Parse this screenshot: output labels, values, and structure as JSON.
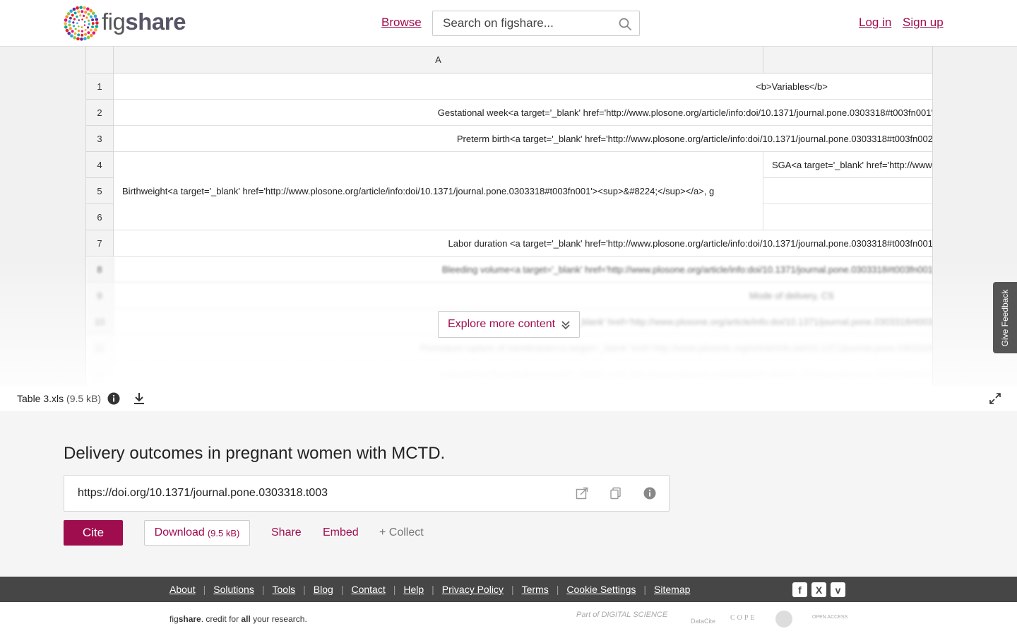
{
  "header": {
    "logo_text_light": "fig",
    "logo_text_bold": "share",
    "browse_label": "Browse",
    "search_placeholder": "Search on figshare...",
    "login_label": "Log in",
    "signup_label": "Sign up"
  },
  "sheet": {
    "column_a_label": "A",
    "column_b_label": "",
    "rows": [
      {
        "num": "1",
        "text": "<b>Variables</b>"
      },
      {
        "num": "2",
        "text": "Gestational week<a target='_blank' href='http://www.plosone.org/article/info:doi/10.1371/journal.pone.0303318#t003fn001'"
      },
      {
        "num": "3",
        "text": "Preterm birth<a target='_blank' href='http://www.plosone.org/article/info:doi/10.1371/journal.pone.0303318#t003fn002"
      },
      {
        "num": "4",
        "text": "SGA<a target='_blank' href='http://www"
      },
      {
        "num": "5",
        "text": "Birthweight<a target='_blank' href='http://www.plosone.org/article/info:doi/10.1371/journal.pone.0303318#t003fn001'><sup>&#8224;</sup></a>, g"
      },
      {
        "num": "6",
        "text": ""
      },
      {
        "num": "7",
        "text": "Labor duration <a target='_blank' href='http://www.plosone.org/article/info:doi/10.1371/journal.pone.0303318#t003fn001"
      },
      {
        "num": "8",
        "text": "Bleeding volume<a target='_blank' href='http://www.plosone.org/article/info:doi/10.1371/journal.pone.0303318#t003fn001"
      },
      {
        "num": "9",
        "text": "Mode of delivery, CS"
      },
      {
        "num": "10",
        "text": "Fetal gr... <a target='_blank' href='http://www.plosone.org/article/info:doi/10.1371/journal.pone.0303318#t003"
      },
      {
        "num": "11",
        "text": "Premature rupture of membranes<a target='_blank' href='http://www.plosone.org/article/info:doi/10.1371/journal.pone.0303318"
      },
      {
        "num": "12",
        "text": "Intrauterine fetal death<a target='_blank' href='http://www.plosone.org/article/info:doi/10.1371/journal.pone.0303318#t003"
      }
    ]
  },
  "explore_label": "Explore more content",
  "feedback_label": "Give Feedback",
  "file": {
    "name": "Table 3.xls",
    "size": "(9.5 kB)"
  },
  "item": {
    "title": "Delivery outcomes in pregnant women with MCTD.",
    "doi": "https://doi.org/10.1371/journal.pone.0303318.t003",
    "cite_label": "Cite",
    "download_label": "Download",
    "download_size": "(9.5 kB)",
    "share_label": "Share",
    "embed_label": "Embed",
    "collect_label": "+ Collect"
  },
  "footer": {
    "links": [
      "About",
      "Solutions",
      "Tools",
      "Blog",
      "Contact",
      "Help",
      "Privacy Policy",
      "Terms",
      "Cookie Settings",
      "Sitemap"
    ],
    "social": [
      "f",
      "X",
      "v"
    ],
    "tagline_1": "fig",
    "tagline_2": "share",
    "tagline_3": ". credit for ",
    "tagline_4": "all",
    "tagline_5": " your research.",
    "partners": [
      "Part of DIGITAL SCIENCE",
      "DataCite",
      "COPE",
      "OPEN ACCESS"
    ]
  },
  "colors": {
    "brand": "#a00d4f",
    "footer": "#464646"
  }
}
